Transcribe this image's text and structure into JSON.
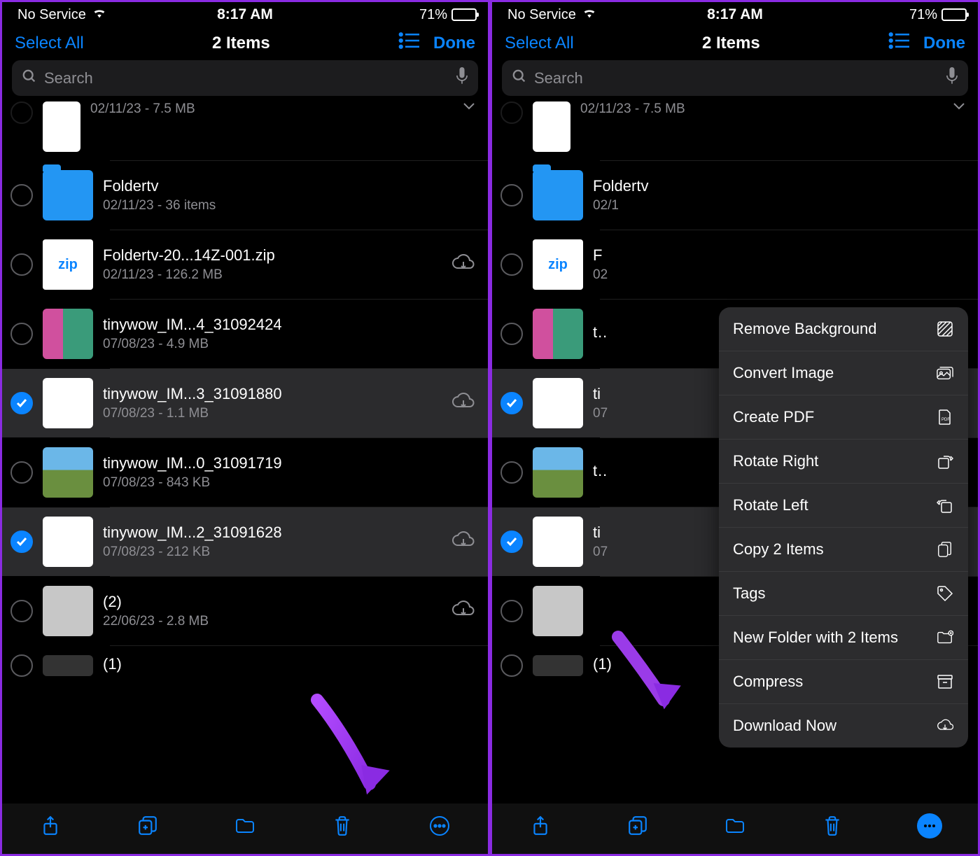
{
  "status": {
    "carrier": "No Service",
    "time": "8:17 AM",
    "battery_pct": "71%"
  },
  "nav": {
    "select_all": "Select All",
    "title": "2 Items",
    "done": "Done"
  },
  "search": {
    "placeholder": "Search"
  },
  "rows": {
    "r0": {
      "name": "",
      "meta": "02/11/23 - 7.5 MB"
    },
    "r1": {
      "name": "Foldertv",
      "meta": "02/11/23 - 36 items"
    },
    "r2": {
      "name": "Foldertv-20...14Z-001.zip",
      "meta": "02/11/23 - 126.2 MB"
    },
    "r3": {
      "name": "tinywow_IM...4_31092424",
      "meta": "07/08/23 - 4.9 MB"
    },
    "r4": {
      "name": "tinywow_IM...3_31091880",
      "meta": "07/08/23 - 1.1 MB"
    },
    "r5": {
      "name": "tinywow_IM...0_31091719",
      "meta": "07/08/23 - 843 KB"
    },
    "r6": {
      "name": "tinywow_IM...2_31091628",
      "meta": "07/08/23 - 212 KB"
    },
    "r7": {
      "name": "(2)",
      "meta": "22/06/23 - 2.8 MB"
    },
    "r8": {
      "name": "(1)",
      "meta": ""
    }
  },
  "rows_b": {
    "r1": {
      "name": "Foldertv",
      "meta": "02/1"
    },
    "r2": {
      "name": "F",
      "meta": "02"
    },
    "r4": {
      "name": "ti",
      "meta": "07"
    },
    "r6": {
      "name": "ti",
      "meta": "07"
    },
    "r8": {
      "name": "(1)",
      "meta": ""
    }
  },
  "menu": {
    "m0": "Remove Background",
    "m1": "Convert Image",
    "m2": "Create PDF",
    "m3": "Rotate Right",
    "m4": "Rotate Left",
    "m5": "Copy 2 Items",
    "m6": "Tags",
    "m7": "New Folder with 2 Items",
    "m8": "Compress",
    "m9": "Download Now"
  },
  "thumb_zip": "zip"
}
